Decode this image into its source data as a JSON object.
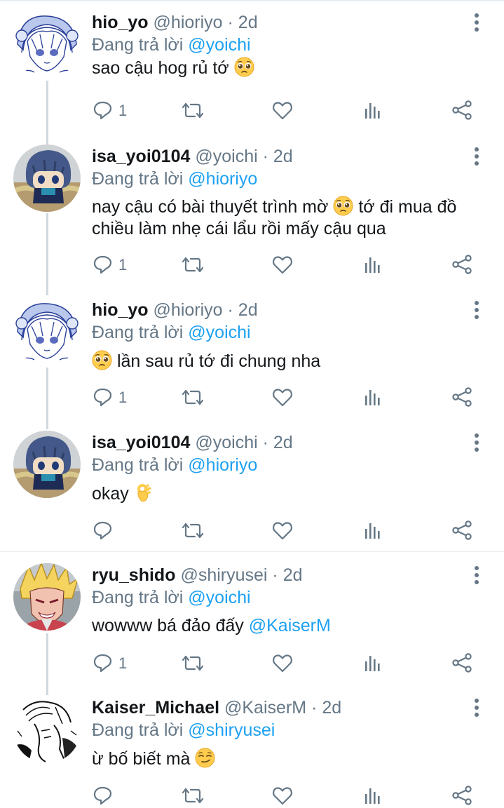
{
  "tweets": [
    {
      "name": "hio_yo",
      "handle": "@hioriyo",
      "time": "2d",
      "reply_prefix": "Đang trả lời",
      "reply_to": "@yoichi",
      "text": "sao cậu hog rủ tớ",
      "emoji": "pleading-face",
      "reply_count": "1",
      "avatar": "anime-white-hair-avatar"
    },
    {
      "name": "isa_yoi0104",
      "handle": "@yoichi",
      "time": "2d",
      "reply_prefix": "Đang trả lời",
      "reply_to": "@hioriyo",
      "text_before": "nay cậu có bài thuyết trình mờ",
      "emoji": "pleading-face",
      "text_after": "tớ đi mua đồ chiều làm nhẹ cái lẩu rồi mấy cậu qua",
      "reply_count": "1",
      "avatar": "plush-doll-avatar"
    },
    {
      "name": "hio_yo",
      "handle": "@hioriyo",
      "time": "2d",
      "reply_prefix": "Đang trả lời",
      "reply_to": "@yoichi",
      "emoji": "pleading-face",
      "text": "lần sau rủ tớ đi chung nha",
      "reply_count": "1",
      "avatar": "anime-white-hair-avatar"
    },
    {
      "name": "isa_yoi0104",
      "handle": "@yoichi",
      "time": "2d",
      "reply_prefix": "Đang trả lời",
      "reply_to": "@hioriyo",
      "text": "okay",
      "emoji": "ok-hand",
      "reply_count": "",
      "avatar": "plush-doll-avatar"
    },
    {
      "name": "ryu_shido",
      "handle": "@shiryusei",
      "time": "2d",
      "reply_prefix": "Đang trả lời",
      "reply_to": "@yoichi",
      "text": "wowww bá đảo đấy",
      "mention": "@KaiserM",
      "reply_count": "1",
      "avatar": "anime-blonde-avatar"
    },
    {
      "name": "Kaiser_Michael",
      "handle": "@KaiserM",
      "time": "2d",
      "reply_prefix": "Đang trả lời",
      "reply_to": "@shiryusei",
      "text": "ừ bố biết mà",
      "emoji": "smirking-face",
      "reply_count": "",
      "avatar": "manga-sketch-avatar"
    }
  ],
  "separator": "·",
  "colors": {
    "link": "#1da1f2",
    "secondary_text": "#657786",
    "primary_text": "#14171a",
    "thread_line": "#cfd9de",
    "divider": "#e6ecf0"
  },
  "action_icons": [
    "reply-icon",
    "retweet-icon",
    "like-icon",
    "stats-icon",
    "share-icon"
  ],
  "more_icon": "more-vertical-icon"
}
